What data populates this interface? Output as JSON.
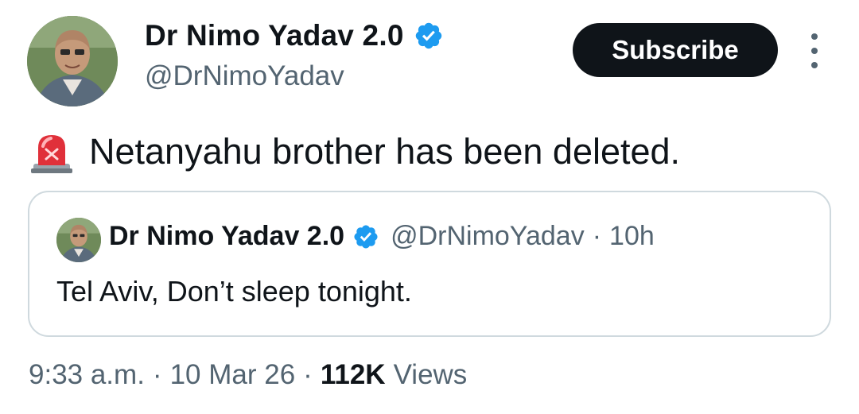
{
  "author": {
    "name": "Dr Nimo Yadav 2.0",
    "handle": "@DrNimoYadav",
    "verified_icon": "verified-badge-icon"
  },
  "actions": {
    "subscribe_label": "Subscribe",
    "more_icon": "more-vertical-icon"
  },
  "tweet": {
    "emoji_icon": "police-siren-icon",
    "text": "Netanyahu brother has been deleted."
  },
  "quoted": {
    "name": "Dr Nimo Yadav 2.0",
    "handle": "@DrNimoYadav",
    "separator": "·",
    "time": "10h",
    "text": "Tel Aviv, Don’t sleep tonight."
  },
  "meta": {
    "time": "9:33 a.m.",
    "sep1": "·",
    "date": "10 Mar 26",
    "sep2": "·",
    "views_count": "112K",
    "views_label": "Views"
  },
  "colors": {
    "text_primary": "#0f1419",
    "text_secondary": "#536471",
    "verified_blue": "#1d9bf0",
    "button_dark": "#0f1419",
    "border": "#cfd9de"
  }
}
